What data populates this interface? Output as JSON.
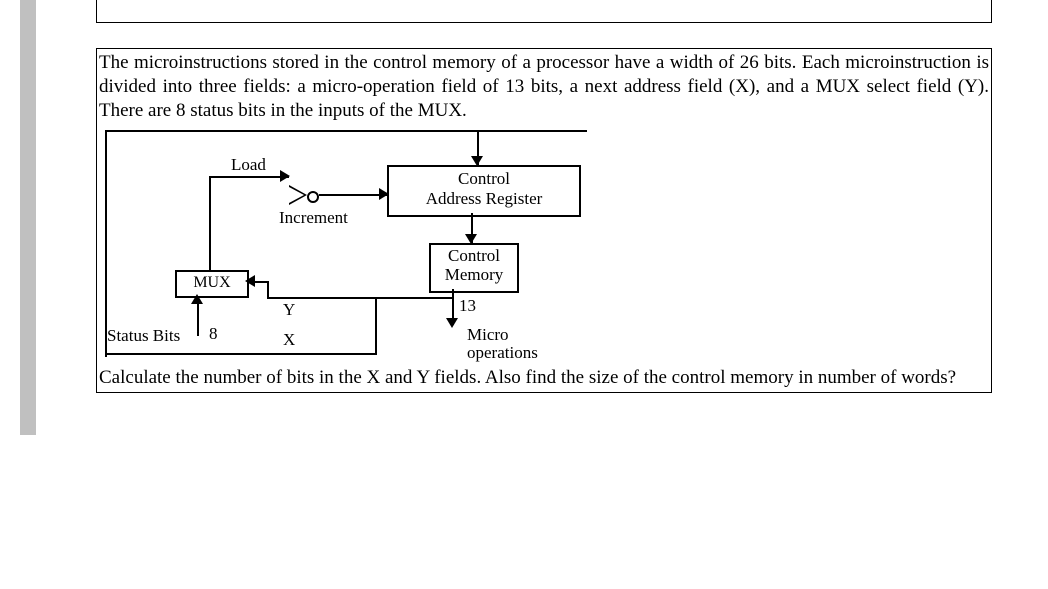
{
  "problem": {
    "intro": "The microinstructions stored in the control memory of a processor have a width of 26 bits. Each microinstruction is divided into three fields: a micro-operation field of 13 bits, a next address field (X), and a MUX select field (Y). There are 8 status bits in the inputs of the MUX.",
    "question": "Calculate the number of bits in the X and Y fields. Also find the size of the control memory in number of words?"
  },
  "diagram": {
    "load_label": "Load",
    "increment_label": "Increment",
    "car_label_line1": "Control",
    "car_label_line2": "Address Register",
    "cm_label_line1": "Control",
    "cm_label_line2": "Memory",
    "mux_label": "MUX",
    "y_label": "Y",
    "x_label": "X",
    "status_bits_label": "Status Bits",
    "status_bits_count": "8",
    "microops_count": "13",
    "microops_label_line1": "Micro",
    "microops_label_line2": "operations"
  }
}
